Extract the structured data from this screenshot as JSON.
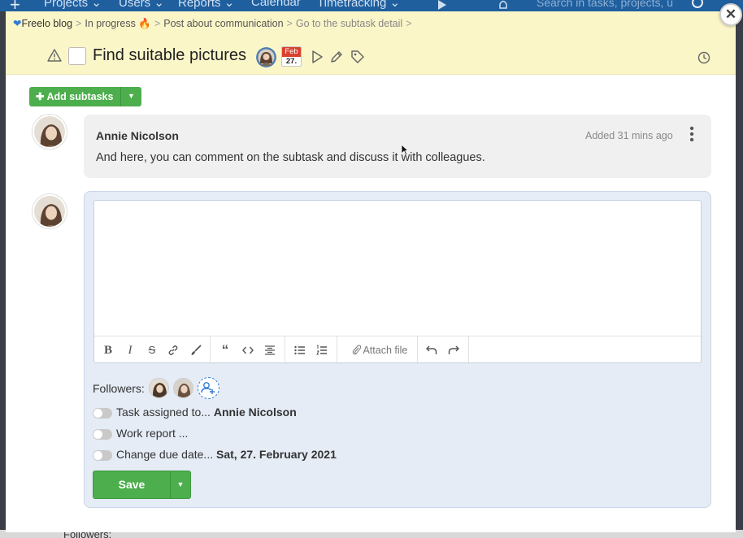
{
  "background_nav": {
    "items": [
      "Projects ⌄",
      "Users ⌄",
      "Reports ⌄",
      "Calendar",
      "Timetracking ⌄"
    ],
    "search_placeholder": "Search in tasks, projects, u"
  },
  "background_bottom": {
    "followers_label": "Followers:"
  },
  "breadcrumb": {
    "items": [
      "Freelo blog",
      "In progress",
      "Post about communication",
      "Go to the subtask detail"
    ],
    "separator": ">"
  },
  "task": {
    "title": "Find suitable pictures",
    "due_month": "Feb",
    "due_day": "27."
  },
  "subtasks": {
    "add_label": "Add subtasks"
  },
  "comment": {
    "author": "Annie Nicolson",
    "added": "Added 31 mins ago",
    "text": "And here, you can comment on the subtask and discuss it with colleagues."
  },
  "editor": {
    "toolbar": {
      "bold": "B",
      "italic": "I",
      "strike": "S",
      "attach_label": "Attach file"
    }
  },
  "followers": {
    "label": "Followers:"
  },
  "options": {
    "assigned_label": "Task assigned to...",
    "assigned_value": "Annie Nicolson",
    "work_report_label": "Work report ...",
    "due_date_label": "Change due date...",
    "due_date_value": "Sat, 27. February 2021"
  },
  "save": {
    "label": "Save"
  },
  "colors": {
    "header_bg": "#fbf6c8",
    "accent_green": "#4cae4c",
    "composer_bg": "#e5ecf6",
    "nav_blue": "#1f5f9e",
    "due_red": "#d9412e"
  }
}
